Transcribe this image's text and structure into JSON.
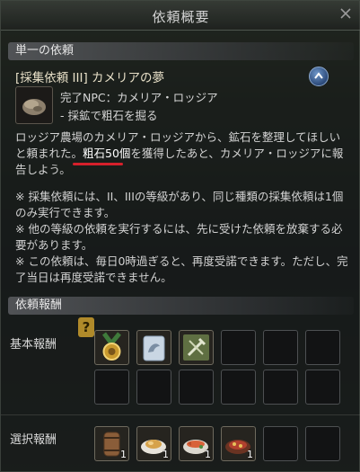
{
  "window": {
    "title": "依頼概要"
  },
  "sections": {
    "single_quest": "単一の依頼",
    "rewards": "依頼報酬"
  },
  "quest": {
    "title": "[採集依頼 III] カメリアの夢",
    "npc_line": "完了NPC：カメリア・ロッジア",
    "objective_line": "- 採鉱で粗石を掘る",
    "desc_part1": "ロッジア農場のカメリア・ロッジアから、鉱石を整理してほしいと頼まれた。",
    "desc_highlight": "粗石50個",
    "desc_part2": "を獲得したあと、カメリア・ロッジアに報告しよう。",
    "notes": [
      "※ 採集依頼には、II、IIIの等級があり、同じ種類の採集依頼は1個のみ実行できます。",
      "※ 他の等級の依頼を実行するには、先に受けた依頼を放棄する必要があります。",
      "※ この依頼は、毎日0時過ぎると、再度受諾できます。ただし、完了当日は再度受諾できません。"
    ]
  },
  "rewards": {
    "basic_label": "基本報酬",
    "choice_label": "選択報酬",
    "qmark": "?",
    "basic_items": [
      {
        "name": "medal-icon"
      },
      {
        "name": "strength-scroll-icon"
      },
      {
        "name": "pickaxe-badge-icon"
      }
    ],
    "choice_items": [
      {
        "name": "barrel-icon",
        "count": "1"
      },
      {
        "name": "bread-dish-icon",
        "count": "1"
      },
      {
        "name": "fish-dish-icon",
        "count": "1"
      },
      {
        "name": "stew-dish-icon",
        "count": "1"
      }
    ]
  }
}
